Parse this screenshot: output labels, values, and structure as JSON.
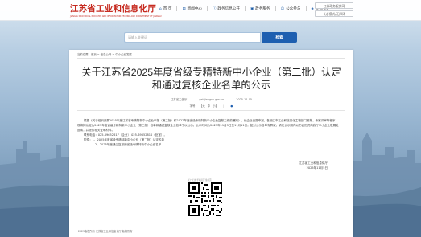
{
  "header": {
    "logo_title": "江苏省工业和信息化厅",
    "logo_subtitle": "JIANGSU PROVINCIAL INDUSTRY AND INFORMATION TECHNOLOGY DEPARTMENT OF JIANGSU",
    "nav": [
      {
        "label": "首 页",
        "icon": "home-icon"
      },
      {
        "label": "新闻中心",
        "icon": "news-icon"
      },
      {
        "label": "政务信息公开",
        "icon": "info-icon"
      },
      {
        "label": "政务服务",
        "icon": "service-icon"
      },
      {
        "label": "公众参与",
        "icon": "people-icon"
      },
      {
        "label": "专题专栏",
        "icon": "topic-icon"
      }
    ],
    "buttons": [
      "江苏政务服务网",
      "长者模式/无障碍"
    ]
  },
  "search": {
    "placeholder": "请输入关键词",
    "button_label": "检索"
  },
  "breadcrumb": {
    "home": "当前位置：",
    "path": "首页 > 信息公开 > 中小企业发展"
  },
  "article": {
    "title": "关于江苏省2025年度省级专精特新中小企业（第二批）认定和通过复核企业名单的公示",
    "source": "江苏省工信厅",
    "email": "gxt.jiangsu.gov.cn",
    "date": "2025-11-05",
    "font_label": "字号：",
    "font_sizes": [
      "大",
      "中",
      "小"
    ],
    "paragraphs": [
      "根据《关于组织开展2025年度江苏省专精特新中小企业申报（第二批）和2022年度省级专精特新中小企业复核工作的通知》，经企业自愿申报、各设区市工业和信息化主管部门推荐、专家评审等程序，现将拟认定为2025年度省级专精特新中小企业（第二批）名单和通过复核企业名单予以公示。公示时间为2025年11月5日至11月11日。如对公示名单有异议，请在公示期内以书面形式向我厅中小企业发展处反映，并提供相关证明材料。",
      "联系电话：025-69652617（企业） 025-69652810（处室）。"
    ],
    "attachment_label": "附件：1．2025年度省级专精特新中小企业（第二批）认定名单",
    "attachment_2": "2．2025年度通过复核的省级专精特新中小企业名单",
    "signature_org": "江苏省工业和信息化厅",
    "signature_date": "2025年11月5日",
    "qr_caption": "扫一扫在手机打开当前页"
  },
  "footer": {
    "copyright": "2025版权所有 江苏省工业和信息化厅 版权所有"
  }
}
